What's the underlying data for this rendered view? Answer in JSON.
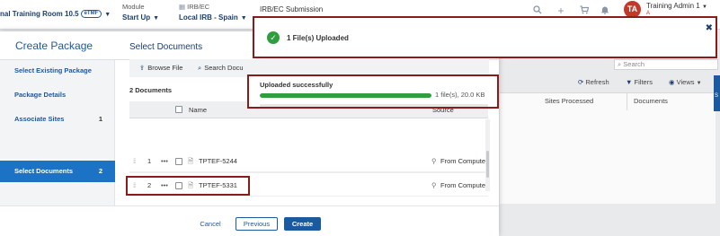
{
  "header": {
    "study_label": "nal Training Room 10.5",
    "study_badge": "eTMF",
    "module_label": "Module",
    "module_value": "Start Up",
    "irb_label": "IRB/EC",
    "irb_value": "Local IRB - Spain",
    "page_title": "IRB/EC Submission",
    "user_initials": "TA",
    "user_name": "Training Admin 1",
    "user_sub": "A"
  },
  "background": {
    "search_placeholder": "Search",
    "refresh_label": "Refresh",
    "filters_label": "Filters",
    "views_label": "Views",
    "col_sites_processed": "Sites Processed",
    "col_documents": "Documents",
    "side_tab_letter": "S"
  },
  "modal": {
    "title": "Create Package",
    "steps": [
      {
        "label": "Select Existing Package",
        "num": ""
      },
      {
        "label": "Package Details",
        "num": ""
      },
      {
        "label": "Associate Sites",
        "num": "1"
      },
      {
        "label": "Select Documents",
        "num": "2"
      }
    ],
    "section_title": "Select Documents",
    "browse_label": "Browse File",
    "search_docs_label": "Search Docu",
    "doc_count": "2 Documents",
    "columns": {
      "name": "Name",
      "source": "Source"
    },
    "rows": [
      {
        "index": "1",
        "name": "TPTEF-5244",
        "source": "From Compute"
      },
      {
        "index": "2",
        "name": "TPTEF-5331",
        "source": "From Compute"
      }
    ],
    "cancel_label": "Cancel",
    "previous_label": "Previous",
    "create_label": "Create"
  },
  "toast": {
    "message": "1 File(s) Uploaded",
    "status_color": "#2e9e3e"
  },
  "upload": {
    "title": "Uploaded successfully",
    "progress": 1.0,
    "info": "1 file(s), 20.0 KB"
  },
  "colors": {
    "accent": "#1c5aa0",
    "highlight": "#8b1a1a",
    "success": "#2e9e3e"
  }
}
